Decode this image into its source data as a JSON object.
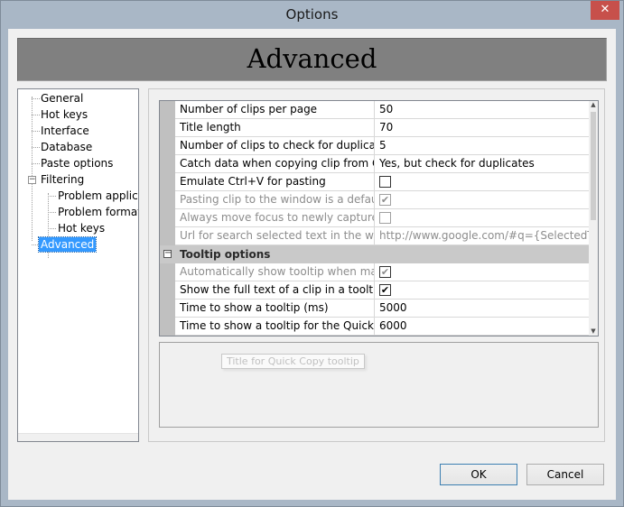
{
  "window": {
    "title": "Options",
    "close_glyph": "✕"
  },
  "banner": {
    "title": "Advanced"
  },
  "tree": {
    "items": [
      {
        "label": "General"
      },
      {
        "label": "Hot keys"
      },
      {
        "label": "Interface"
      },
      {
        "label": "Database"
      },
      {
        "label": "Paste options"
      },
      {
        "label": "Filtering"
      },
      {
        "label": "Problem applicat"
      },
      {
        "label": "Problem formats"
      },
      {
        "label": "Hot keys"
      },
      {
        "label": "Advanced"
      }
    ],
    "filtering_expander": "−"
  },
  "grid": {
    "rows": [
      {
        "name": "Number of clips per page",
        "value": "50"
      },
      {
        "name": "Title length",
        "value": "70"
      },
      {
        "name": "Number of clips to check for duplicate",
        "value": "5"
      },
      {
        "name": "Catch data when copying clip from Clipdiary",
        "value": "Yes, but check for duplicates"
      },
      {
        "name": "Emulate Ctrl+V for pasting",
        "value": ""
      },
      {
        "name": "Pasting clip to the window is a default action",
        "value": ""
      },
      {
        "name": "Always move focus to newly captured clip",
        "value": ""
      },
      {
        "name": "Url for search selected text in the web",
        "value": "http://www.google.com/#q={SelectedText}"
      }
    ],
    "category": {
      "label": "Tooltip options",
      "collapse_glyph": "−"
    },
    "tooltip_rows": [
      {
        "name": "Automatically show tooltip when main window",
        "value": ""
      },
      {
        "name": "Show the full text of a clip in a tooltip",
        "value": ""
      },
      {
        "name": "Time to show a tooltip (ms)",
        "value": "5000"
      },
      {
        "name": "Time to show a tooltip for the Quick Copy",
        "value": "6000"
      }
    ],
    "check_glyph": "✔"
  },
  "description": {
    "tooltip_ghost": "Title for Quick Copy tooltip"
  },
  "buttons": {
    "ok": "OK",
    "cancel": "Cancel"
  }
}
